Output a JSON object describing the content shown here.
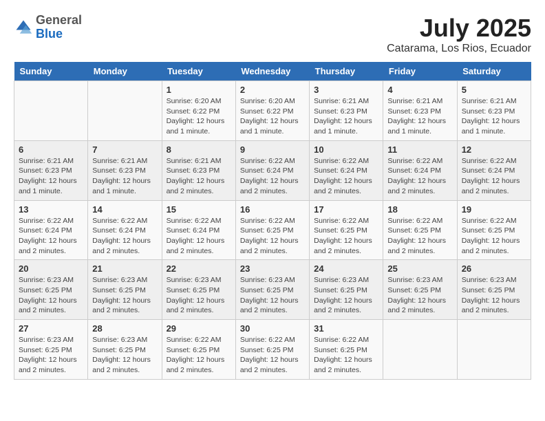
{
  "header": {
    "logo_general": "General",
    "logo_blue": "Blue",
    "month_title": "July 2025",
    "subtitle": "Catarama, Los Rios, Ecuador"
  },
  "calendar": {
    "days_of_week": [
      "Sunday",
      "Monday",
      "Tuesday",
      "Wednesday",
      "Thursday",
      "Friday",
      "Saturday"
    ],
    "weeks": [
      [
        {
          "day": "",
          "info": ""
        },
        {
          "day": "",
          "info": ""
        },
        {
          "day": "1",
          "info": "Sunrise: 6:20 AM\nSunset: 6:22 PM\nDaylight: 12 hours\nand 1 minute."
        },
        {
          "day": "2",
          "info": "Sunrise: 6:20 AM\nSunset: 6:22 PM\nDaylight: 12 hours\nand 1 minute."
        },
        {
          "day": "3",
          "info": "Sunrise: 6:21 AM\nSunset: 6:23 PM\nDaylight: 12 hours\nand 1 minute."
        },
        {
          "day": "4",
          "info": "Sunrise: 6:21 AM\nSunset: 6:23 PM\nDaylight: 12 hours\nand 1 minute."
        },
        {
          "day": "5",
          "info": "Sunrise: 6:21 AM\nSunset: 6:23 PM\nDaylight: 12 hours\nand 1 minute."
        }
      ],
      [
        {
          "day": "6",
          "info": "Sunrise: 6:21 AM\nSunset: 6:23 PM\nDaylight: 12 hours\nand 1 minute."
        },
        {
          "day": "7",
          "info": "Sunrise: 6:21 AM\nSunset: 6:23 PM\nDaylight: 12 hours\nand 1 minute."
        },
        {
          "day": "8",
          "info": "Sunrise: 6:21 AM\nSunset: 6:23 PM\nDaylight: 12 hours\nand 2 minutes."
        },
        {
          "day": "9",
          "info": "Sunrise: 6:22 AM\nSunset: 6:24 PM\nDaylight: 12 hours\nand 2 minutes."
        },
        {
          "day": "10",
          "info": "Sunrise: 6:22 AM\nSunset: 6:24 PM\nDaylight: 12 hours\nand 2 minutes."
        },
        {
          "day": "11",
          "info": "Sunrise: 6:22 AM\nSunset: 6:24 PM\nDaylight: 12 hours\nand 2 minutes."
        },
        {
          "day": "12",
          "info": "Sunrise: 6:22 AM\nSunset: 6:24 PM\nDaylight: 12 hours\nand 2 minutes."
        }
      ],
      [
        {
          "day": "13",
          "info": "Sunrise: 6:22 AM\nSunset: 6:24 PM\nDaylight: 12 hours\nand 2 minutes."
        },
        {
          "day": "14",
          "info": "Sunrise: 6:22 AM\nSunset: 6:24 PM\nDaylight: 12 hours\nand 2 minutes."
        },
        {
          "day": "15",
          "info": "Sunrise: 6:22 AM\nSunset: 6:24 PM\nDaylight: 12 hours\nand 2 minutes."
        },
        {
          "day": "16",
          "info": "Sunrise: 6:22 AM\nSunset: 6:25 PM\nDaylight: 12 hours\nand 2 minutes."
        },
        {
          "day": "17",
          "info": "Sunrise: 6:22 AM\nSunset: 6:25 PM\nDaylight: 12 hours\nand 2 minutes."
        },
        {
          "day": "18",
          "info": "Sunrise: 6:22 AM\nSunset: 6:25 PM\nDaylight: 12 hours\nand 2 minutes."
        },
        {
          "day": "19",
          "info": "Sunrise: 6:22 AM\nSunset: 6:25 PM\nDaylight: 12 hours\nand 2 minutes."
        }
      ],
      [
        {
          "day": "20",
          "info": "Sunrise: 6:23 AM\nSunset: 6:25 PM\nDaylight: 12 hours\nand 2 minutes."
        },
        {
          "day": "21",
          "info": "Sunrise: 6:23 AM\nSunset: 6:25 PM\nDaylight: 12 hours\nand 2 minutes."
        },
        {
          "day": "22",
          "info": "Sunrise: 6:23 AM\nSunset: 6:25 PM\nDaylight: 12 hours\nand 2 minutes."
        },
        {
          "day": "23",
          "info": "Sunrise: 6:23 AM\nSunset: 6:25 PM\nDaylight: 12 hours\nand 2 minutes."
        },
        {
          "day": "24",
          "info": "Sunrise: 6:23 AM\nSunset: 6:25 PM\nDaylight: 12 hours\nand 2 minutes."
        },
        {
          "day": "25",
          "info": "Sunrise: 6:23 AM\nSunset: 6:25 PM\nDaylight: 12 hours\nand 2 minutes."
        },
        {
          "day": "26",
          "info": "Sunrise: 6:23 AM\nSunset: 6:25 PM\nDaylight: 12 hours\nand 2 minutes."
        }
      ],
      [
        {
          "day": "27",
          "info": "Sunrise: 6:23 AM\nSunset: 6:25 PM\nDaylight: 12 hours\nand 2 minutes."
        },
        {
          "day": "28",
          "info": "Sunrise: 6:23 AM\nSunset: 6:25 PM\nDaylight: 12 hours\nand 2 minutes."
        },
        {
          "day": "29",
          "info": "Sunrise: 6:22 AM\nSunset: 6:25 PM\nDaylight: 12 hours\nand 2 minutes."
        },
        {
          "day": "30",
          "info": "Sunrise: 6:22 AM\nSunset: 6:25 PM\nDaylight: 12 hours\nand 2 minutes."
        },
        {
          "day": "31",
          "info": "Sunrise: 6:22 AM\nSunset: 6:25 PM\nDaylight: 12 hours\nand 2 minutes."
        },
        {
          "day": "",
          "info": ""
        },
        {
          "day": "",
          "info": ""
        }
      ]
    ]
  }
}
